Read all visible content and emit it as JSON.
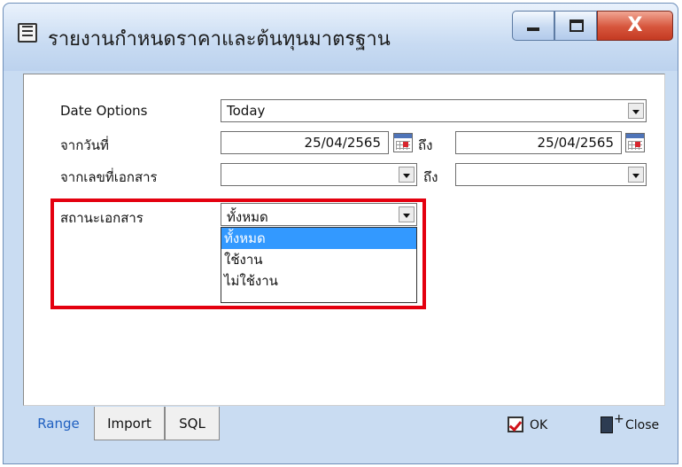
{
  "window": {
    "title": "รายงานกำหนดราคาและต้นทุนมาตรฐาน",
    "close_glyph": "X"
  },
  "form": {
    "date_options_label": "Date Options",
    "date_options_value": "Today",
    "from_date_label": "จากวันที่",
    "from_date_value": "25/04/2565",
    "to_label": "ถึง",
    "to_date_value": "25/04/2565",
    "from_doc_label": "จากเลขที่เอกสาร",
    "from_doc_value": "",
    "to_doc_value": "",
    "doc_status_label": "สถานะเอกสาร",
    "doc_status_value": "ทั้งหมด",
    "doc_status_options": [
      "ทั้งหมด",
      "ใช้งาน",
      "ไม่ใช้งาน"
    ]
  },
  "tabs": [
    "Range",
    "Import",
    "SQL"
  ],
  "footer": {
    "ok_label": "OK",
    "close_label": "Close"
  },
  "colors": {
    "highlight": "#e4000f",
    "selected_option": "#3399ff",
    "active_tab_text": "#2060c0"
  }
}
